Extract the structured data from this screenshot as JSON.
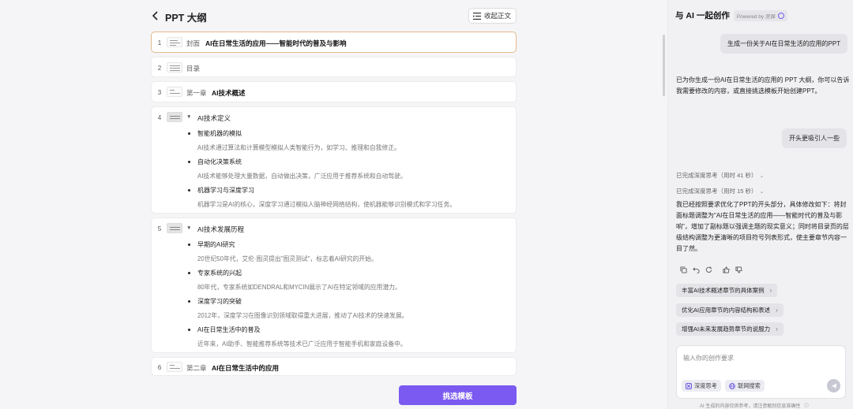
{
  "header": {
    "title": "PPT 大纲",
    "collapse_label": "收起正文"
  },
  "outline": {
    "rows": [
      {
        "num": "1",
        "label": "封面",
        "title": "AI在日常生活的应用——智能时代的普及与影响"
      },
      {
        "num": "2",
        "label": "目录"
      },
      {
        "num": "3",
        "label": "第一章",
        "title": "AI技术概述"
      },
      {
        "num": "4",
        "section": "AI技术定义",
        "items": [
          {
            "title": "智能机器的模拟",
            "desc": "AI技术通过算法和计算模型模拟人类智能行为，如学习、推理和自我修正。"
          },
          {
            "title": "自动化决策系统",
            "desc": "AI技术能够处理大量数据，自动做出决策，广泛应用于推荐系统和自动驾驶。"
          },
          {
            "title": "机器学习与深度学习",
            "desc": "机器学习是AI的核心，深度学习通过模拟人脑神经网络结构，使机器能够识别模式和学习任务。"
          }
        ]
      },
      {
        "num": "5",
        "section": "AI技术发展历程",
        "items": [
          {
            "title": "早期的AI研究",
            "desc": "20世纪50年代，艾伦·图灵提出\"图灵测试\"，标志着AI研究的开始。"
          },
          {
            "title": "专家系统的兴起",
            "desc": "80年代，专家系统如DENDRAL和MYCIN展示了AI在特定领域的应用潜力。"
          },
          {
            "title": "深度学习的突破",
            "desc": "2012年，深度学习在图像识别领域取得重大进展，推动了AI技术的快速发展。"
          },
          {
            "title": "AI在日常生活中的普及",
            "desc": "近年来，AI助手、智能推荐系统等技术已广泛应用于智能手机和家庭设备中。"
          }
        ]
      },
      {
        "num": "6",
        "label": "第二章",
        "title": "AI在日常生活中的应用"
      }
    ],
    "choose_template_label": "挑选模板"
  },
  "chat": {
    "title": "与 AI 一起创作",
    "powered_by": "Powered by 灵犀",
    "messages": {
      "user1": "生成一份关于AI在日常生活的应用的PPT",
      "ai1": "已为你生成一份AI在日常生活的应用的 PPT 大纲，你可以告诉我需要修改的内容，或直接挑选模板开始创建PPT。",
      "user2": "开头更吸引人一些",
      "think1": "已完成深度思考（用时 41 秒）",
      "think2": "已完成深度思考（用时 15 秒）",
      "ai2": "我已经按照要求优化了PPT的开头部分，具体修改如下：将封面标题调整为\"AI在日常生活的应用——智能时代的普及与影响\"，增加了副标题以强调主题的现实意义；同时将目录页的层级结构调整为更清晰的项目符号列表形式，使主要章节内容一目了然。"
    },
    "suggestions": [
      "丰富AI技术概述章节的具体案例",
      "优化AI应用章节的内容结构和表述",
      "增强AI未来发展趋势章节的说服力"
    ],
    "input": {
      "placeholder": "输入你的创作要求",
      "value": ""
    },
    "chips": {
      "deep_think": "深度思考",
      "web_search": "联网搜索"
    },
    "disclaimer": "AI 生成的内容仅供参考，请注意甄别信息准确性",
    "accent_color": "#7a5af0"
  }
}
